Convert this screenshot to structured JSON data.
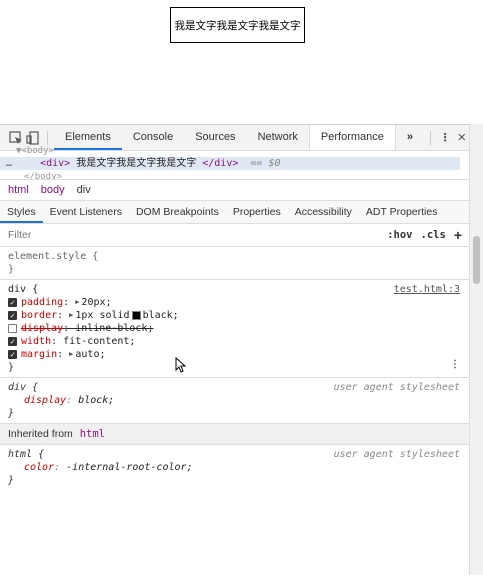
{
  "page": {
    "demo_text": "我是文字我是文字我是文字"
  },
  "toolbar": {
    "tabs": [
      "Elements",
      "Console",
      "Sources",
      "Network",
      "Performance"
    ],
    "more_label": "»",
    "menu_label": "⋮",
    "close_label": "×"
  },
  "elements_panel": {
    "top_line": "▼<body>",
    "selected_line": {
      "ellipsis": "…",
      "open_tag": "<div>",
      "text": "我是文字我是文字我是文字",
      "close_tag": "</div>",
      "eq": "== $0"
    },
    "bottom_line": "</body>"
  },
  "breadcrumbs": [
    "html",
    "body",
    "div"
  ],
  "subtabs": [
    "Styles",
    "Event Listeners",
    "DOM Breakpoints",
    "Properties",
    "Accessibility",
    "ADT Properties"
  ],
  "filter": {
    "placeholder": "Filter",
    "hov": ":hov",
    "cls": ".cls",
    "add": "+"
  },
  "element_style": {
    "selector": "element.style {",
    "close": "}"
  },
  "div_rule": {
    "selector": "div {",
    "source": "test.html:3",
    "close": "}",
    "props": [
      {
        "name": "padding",
        "value": "20px;",
        "checked": true,
        "arrow": "▶",
        "strike": false
      },
      {
        "name": "border",
        "value": "1px solid",
        "value2": "black;",
        "checked": true,
        "arrow": "▶",
        "swatch": true,
        "strike": false
      },
      {
        "name": "display",
        "value": "inline-block;",
        "checked": false,
        "strike": true
      },
      {
        "name": "width",
        "value": "fit-content;",
        "checked": true,
        "strike": false
      },
      {
        "name": "margin",
        "value": "auto;",
        "checked": true,
        "arrow": "▶",
        "strike": false
      }
    ]
  },
  "ua_div": {
    "selector": "div {",
    "source": "user agent stylesheet",
    "prop": "display",
    "value": "block;",
    "close": "}"
  },
  "inherited": {
    "label": "Inherited from",
    "tag": "html"
  },
  "ua_html": {
    "selector": "html {",
    "source": "user agent stylesheet",
    "prop": "color",
    "value": "-internal-root-color;",
    "close": "}"
  }
}
